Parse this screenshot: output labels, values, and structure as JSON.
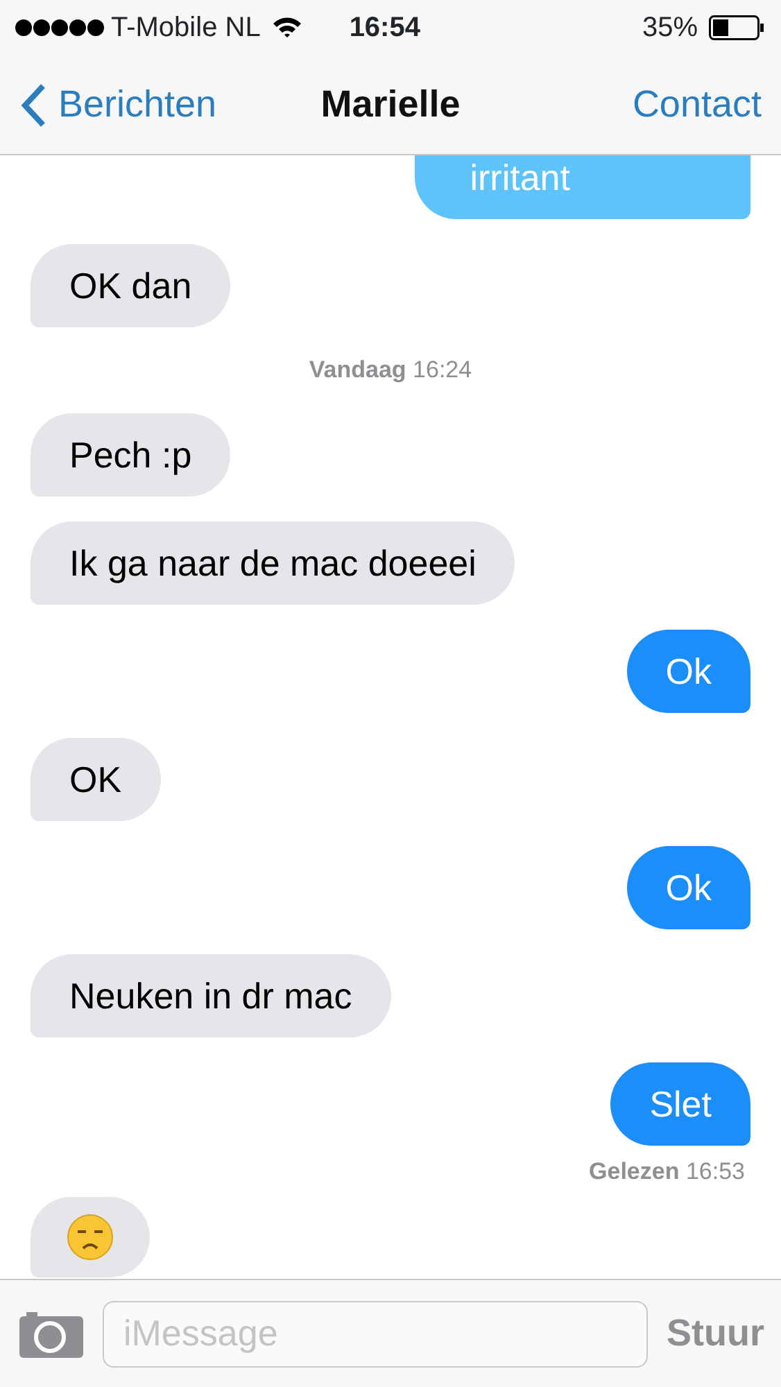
{
  "status_bar": {
    "carrier": "T-Mobile NL",
    "time": "16:54",
    "battery": "35%"
  },
  "nav": {
    "back": "Berichten",
    "title": "Marielle",
    "action": "Contact"
  },
  "messages": [
    {
      "kind": "sent",
      "text": "irritant"
    },
    {
      "kind": "received",
      "text": "OK dan"
    },
    {
      "kind": "timestamp",
      "day": "Vandaag",
      "time": "16:24"
    },
    {
      "kind": "received",
      "text": "Pech :p"
    },
    {
      "kind": "received",
      "text": "Ik ga naar de mac doeeei"
    },
    {
      "kind": "sent",
      "text": "Ok"
    },
    {
      "kind": "received",
      "text": "OK"
    },
    {
      "kind": "sent",
      "text": "Ok"
    },
    {
      "kind": "received",
      "text": "Neuken in dr mac"
    },
    {
      "kind": "sent",
      "text": "Slet"
    },
    {
      "kind": "receipt",
      "label": "Gelezen",
      "time": "16:53"
    },
    {
      "kind": "emoji"
    }
  ],
  "composer": {
    "placeholder": "iMessage",
    "send": "Stuur"
  }
}
